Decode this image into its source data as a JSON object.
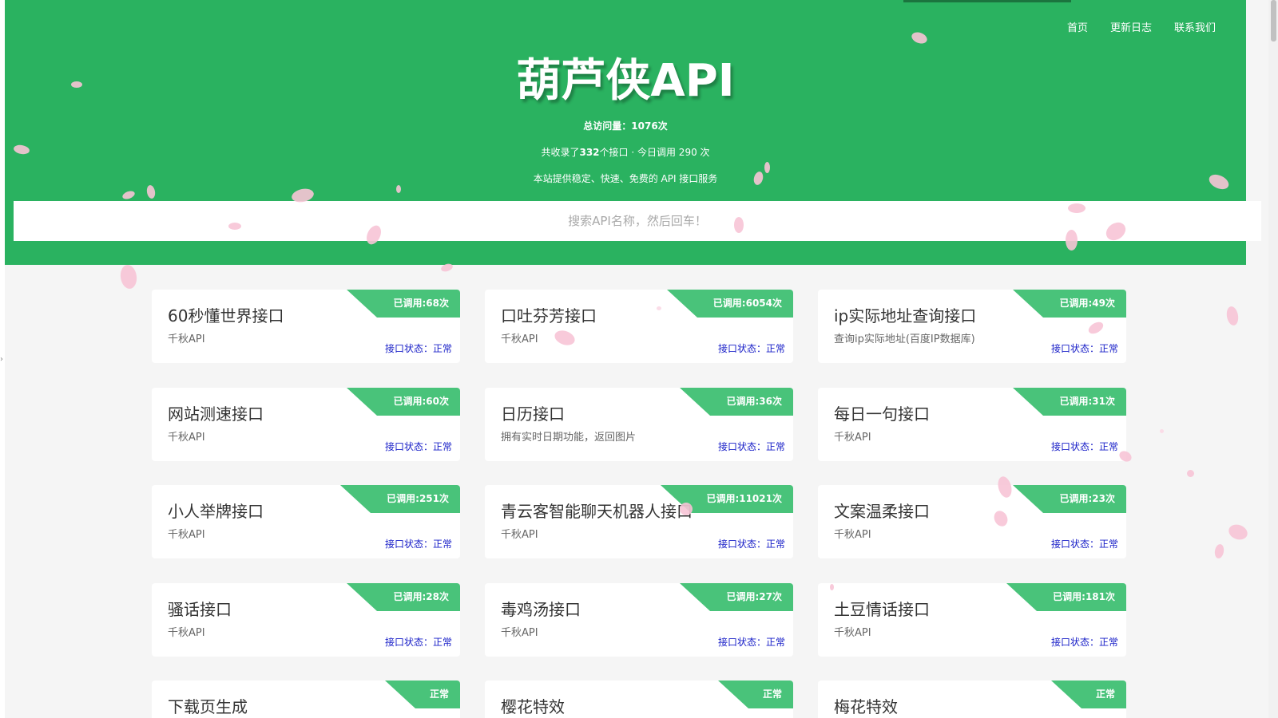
{
  "nav": {
    "items": [
      "首页",
      "更新日志",
      "联系我们"
    ]
  },
  "header": {
    "title": "葫芦侠API",
    "visits_prefix": "总访问量：",
    "visits_value": "1076次",
    "collect_prefix": "共收录了",
    "collect_count": "332",
    "collect_suffix": "个接口 · 今日调用 290 次",
    "slogan": "本站提供稳定、快速、免费的 API 接口服务"
  },
  "search": {
    "placeholder": "搜索API名称，然后回车！"
  },
  "colors": {
    "brand_green": "#2ab260",
    "badge_green": "#49c37a",
    "status_blue": "#1a20c8"
  },
  "cards": [
    {
      "name": "60秒懂世界接口",
      "desc": "千秋API",
      "badge": "已调用:68次",
      "status": "接口状态：正常"
    },
    {
      "name": "口吐芬芳接口",
      "desc": "千秋API",
      "badge": "已调用:6054次",
      "status": "接口状态：正常"
    },
    {
      "name": "ip实际地址查询接口",
      "desc": "查询ip实际地址(百度IP数据库)",
      "badge": "已调用:49次",
      "status": "接口状态：正常"
    },
    {
      "name": "网站测速接口",
      "desc": "千秋API",
      "badge": "已调用:60次",
      "status": "接口状态：正常"
    },
    {
      "name": "日历接口",
      "desc": "拥有实时日期功能，返回图片",
      "badge": "已调用:36次",
      "status": "接口状态：正常"
    },
    {
      "name": "每日一句接口",
      "desc": "千秋API",
      "badge": "已调用:31次",
      "status": "接口状态：正常"
    },
    {
      "name": "小人举牌接口",
      "desc": "千秋API",
      "badge": "已调用:251次",
      "status": "接口状态：正常"
    },
    {
      "name": "青云客智能聊天机器人接口",
      "desc": "千秋API",
      "badge": "已调用:11021次",
      "status": "接口状态：正常"
    },
    {
      "name": "文案温柔接口",
      "desc": "千秋API",
      "badge": "已调用:23次",
      "status": "接口状态：正常"
    },
    {
      "name": "骚话接口",
      "desc": "千秋API",
      "badge": "已调用:28次",
      "status": "接口状态：正常"
    },
    {
      "name": "毒鸡汤接口",
      "desc": "千秋API",
      "badge": "已调用:27次",
      "status": "接口状态：正常"
    },
    {
      "name": "土豆情话接口",
      "desc": "千秋API",
      "badge": "已调用:181次",
      "status": "接口状态：正常"
    },
    {
      "name": "下载页生成",
      "desc": "",
      "badge": "正常",
      "status": ""
    },
    {
      "name": "樱花特效",
      "desc": "",
      "badge": "正常",
      "status": ""
    },
    {
      "name": "梅花特效",
      "desc": "",
      "badge": "正常",
      "status": ""
    }
  ]
}
